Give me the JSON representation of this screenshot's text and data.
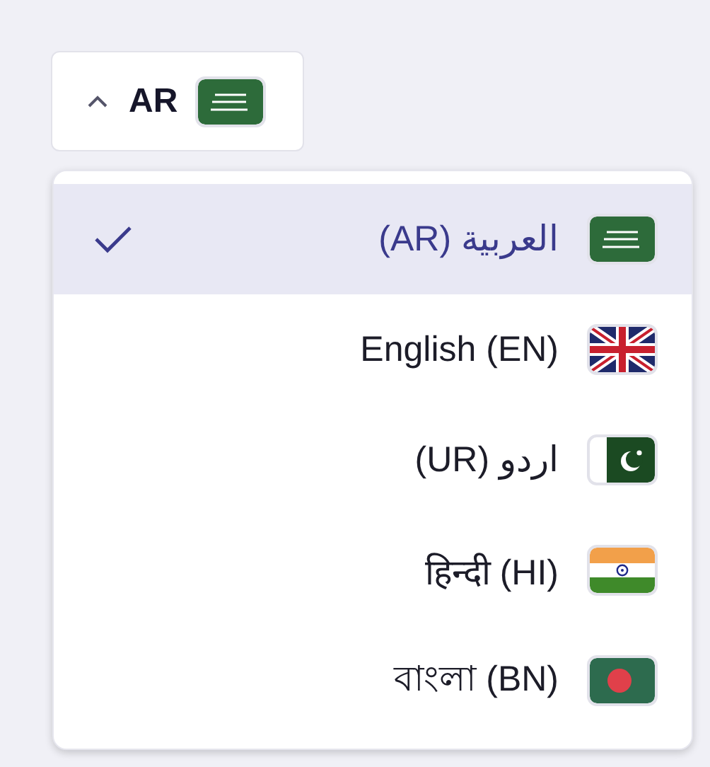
{
  "trigger": {
    "label": "AR",
    "kind": "sa",
    "expanded": true
  },
  "options": [
    {
      "label": "العربية (AR)",
      "kind": "sa",
      "selected": true
    },
    {
      "label": "English (EN)",
      "kind": "gb",
      "selected": false
    },
    {
      "label": "اردو (UR)",
      "kind": "pk",
      "selected": false
    },
    {
      "label": "हिन्दी (HI)",
      "kind": "in",
      "selected": false
    },
    {
      "label": "বাংলা (BN)",
      "kind": "bd",
      "selected": false
    }
  ]
}
